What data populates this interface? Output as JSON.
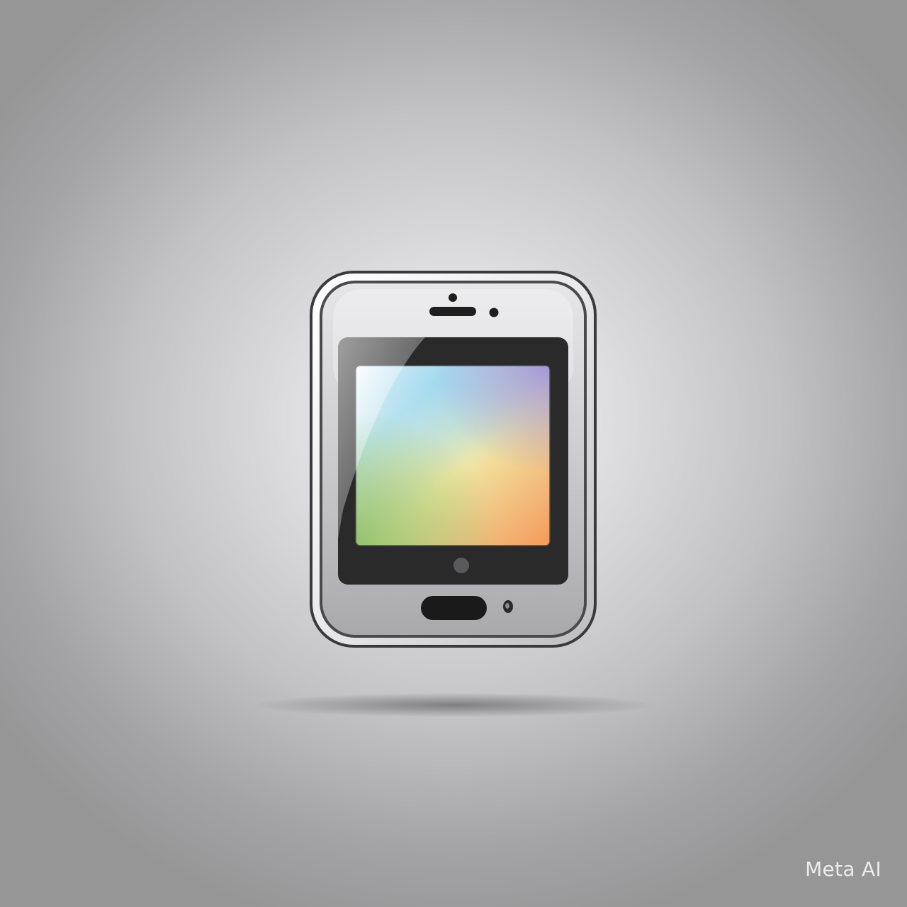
{
  "scene": {
    "subject": "mobile-phone-icon",
    "background_color": "#c8c8cb",
    "phone_body_color": "#d4d4d6",
    "bezel_color": "#2a2a2a",
    "screen_gradient_colors": [
      "#ffffff",
      "#a9dced",
      "#f2e7a0",
      "#f5a35e",
      "#97c46f",
      "#a79ae0"
    ]
  },
  "watermark": {
    "text": "Meta AI"
  }
}
